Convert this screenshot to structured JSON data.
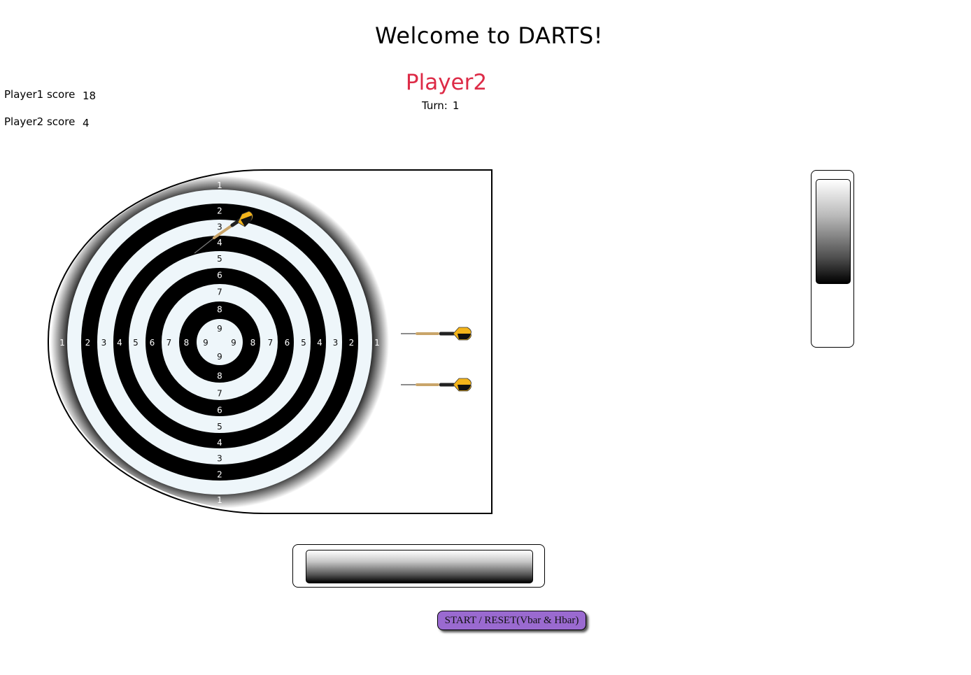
{
  "header": {
    "title": "Welcome to DARTS!",
    "current_player": "Player2",
    "turn_label": "Turn:",
    "turn_value": "1"
  },
  "scores": [
    {
      "label": "Player1 score",
      "value": "18"
    },
    {
      "label": "Player2 score",
      "value": "4"
    }
  ],
  "board": {
    "ring_numbers": [
      "1",
      "2",
      "3",
      "4",
      "5",
      "6",
      "7",
      "8",
      "9"
    ],
    "colors": {
      "dark": "#000000",
      "light": "#eef6fa",
      "dart_flight": "#f4b41a",
      "dart_barrel": "#c9a56a"
    }
  },
  "darts_remaining": 2,
  "controls": {
    "start_reset_label": "START / RESET(Vbar & Hbar)",
    "button_color": "#9a6ad0"
  },
  "accent_colors": {
    "current_player": "#dd2b47"
  }
}
